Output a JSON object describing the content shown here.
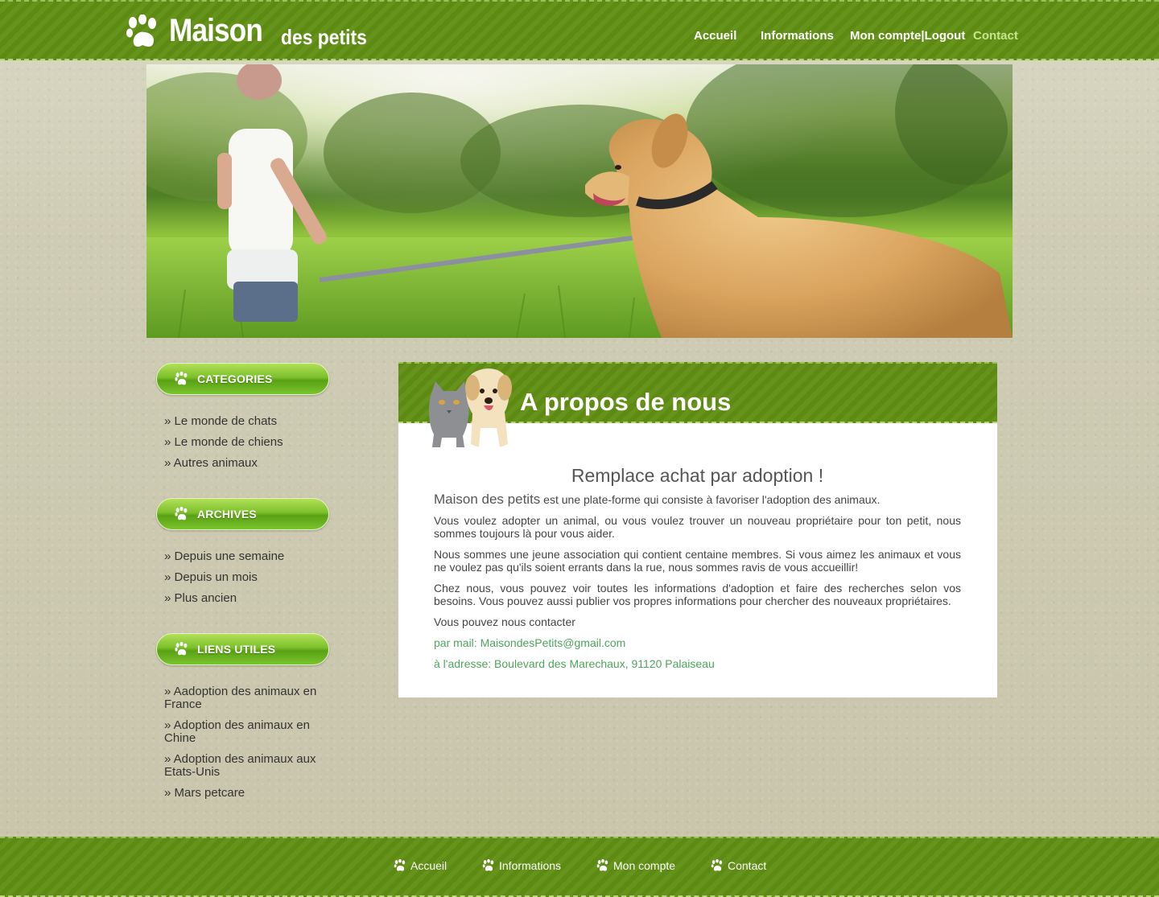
{
  "header": {
    "logo_main": "Maison",
    "logo_sub": "des petits",
    "nav": [
      {
        "label": "Accueil"
      },
      {
        "label": "Informations"
      },
      {
        "label": "Mon compte|Logout"
      },
      {
        "label": "Contact"
      }
    ]
  },
  "sidebar": {
    "sections": [
      {
        "title": "CATEGORIES",
        "items": [
          "» Le monde de chats",
          "» Le monde de chiens",
          "» Autres animaux"
        ]
      },
      {
        "title": "ARCHIVES",
        "items": [
          "» Depuis une semaine",
          "» Depuis un mois",
          "» Plus ancien"
        ]
      },
      {
        "title": "LIENS UTILES",
        "items": [
          "» Aadoption des animaux en France",
          "» Adoption des animaux en Chine",
          "» Adoption des animaux aux Etats-Unis",
          "» Mars petcare"
        ]
      }
    ]
  },
  "main": {
    "title": "A propos de nous",
    "subtitle": "Remplace achat par adoption !",
    "brand": "Maison des petits",
    "intro_rest": " est une plate-forme qui consiste à favoriser l'adoption des animaux.",
    "paragraphs": [
      "Vous voulez adopter un animal, ou vous voulez trouver un nouveau propriétaire pour ton petit, nous sommes toujours là pour vous aider.",
      "Nous sommes une jeune association qui contient centaine membres. Si vous aimez les animaux et vous ne voulez pas qu'ils soient errants dans la rue, nous sommes ravis de vous accueillir!",
      "Chez nous, vous pouvez voir toutes les informations d'adoption et faire des recherches selon vos besoins. Vous pouvez aussi publier vos propres informations pour chercher des nouveaux propriétaires.",
      "Vous pouvez nous contacter"
    ],
    "contact_mail": "par mail: MaisondesPetits@gmail.com",
    "contact_address": "à l'adresse: Boulevard des Marechaux, 91120 Palaiseau"
  },
  "footer": {
    "links": [
      {
        "label": "Accueil"
      },
      {
        "label": "Informations"
      },
      {
        "label": "Mon compte"
      },
      {
        "label": "Contact"
      }
    ]
  },
  "colors": {
    "header_green": "#5d8a13",
    "active_nav": "#c7e58f",
    "contact_text": "#4fa35d"
  },
  "icons": {
    "paw": "paw-icon"
  }
}
